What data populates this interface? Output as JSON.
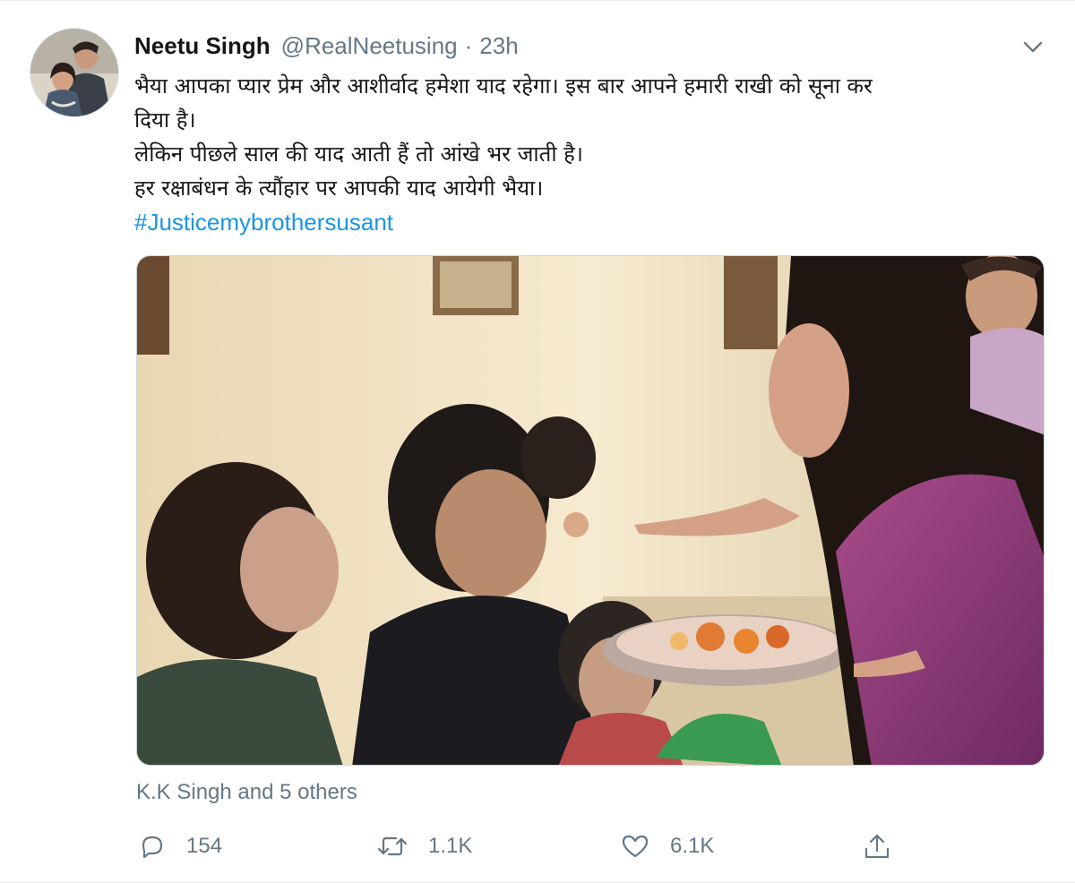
{
  "tweet": {
    "display_name": "Neetu Singh",
    "handle": "@RealNeetusing",
    "separator": "·",
    "time": "23h",
    "text_line1": "भैया आपका प्यार प्रेम और आशीर्वाद हमेशा याद रहेगा। इस बार आपने हमारी राखी को सूना कर",
    "text_line2": "दिया है।",
    "text_line3": "लेकिन पीछले साल की याद आती हैं तो आंखे भर जाती है।",
    "text_line4": "हर रक्षाबंधन के त्यौंहार पर आपकी याद आयेगी भैया।",
    "hashtag": "#Justicemybrothersusant",
    "tagged": "K.K Singh and 5 others"
  },
  "actions": {
    "reply_count": "154",
    "retweet_count": "1.1K",
    "like_count": "6.1K"
  },
  "icons": {
    "caret": "chevron-down-icon",
    "reply": "reply-icon",
    "retweet": "retweet-icon",
    "like": "heart-icon",
    "share": "share-icon"
  },
  "colors": {
    "text": "#14171a",
    "secondary": "#657786",
    "link": "#1b95e0",
    "border": "#e6ecf0"
  }
}
